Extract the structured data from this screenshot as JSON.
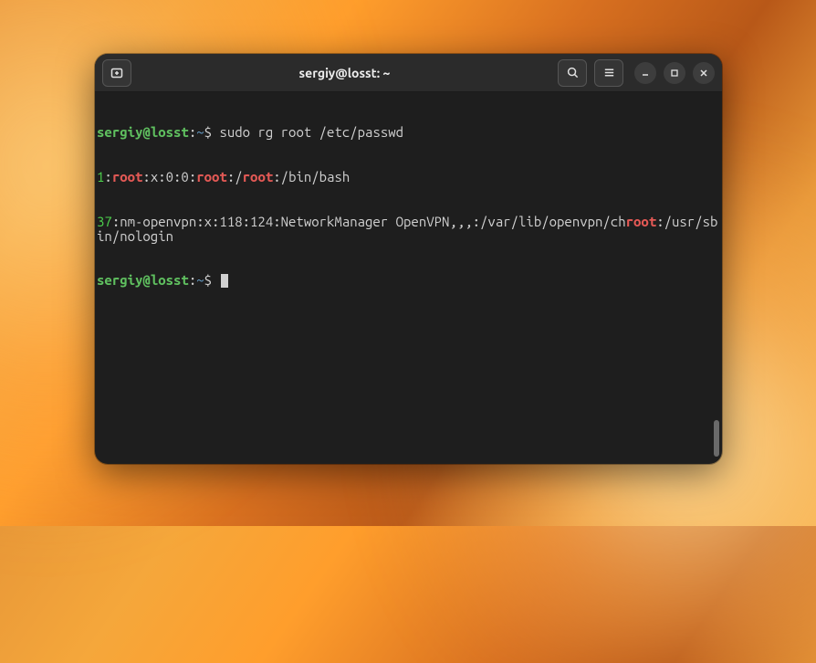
{
  "titlebar": {
    "title": "sergiy@losst: ~"
  },
  "prompt1": {
    "user": "sergiy",
    "at": "@",
    "host": "losst",
    "colon": ":",
    "tilde": "~",
    "dollar": "$ ",
    "command": "sudo rg root /etc/passwd"
  },
  "output": {
    "line1": {
      "num": "1",
      "c1": ":",
      "m1": "root",
      "t1": ":x:0:0:",
      "m2": "root",
      "t2": ":/",
      "m3": "root",
      "t3": ":/bin/bash"
    },
    "line2": {
      "num": "37",
      "c1": ":nm-openvpn:x:118:124:NetworkManager OpenVPN,,,:/var/lib/openvpn/ch",
      "m1": "root",
      "t1": ":/usr/sbin/nologin"
    }
  },
  "prompt2": {
    "user": "sergiy",
    "at": "@",
    "host": "losst",
    "colon": ":",
    "tilde": "~",
    "dollar": "$ "
  }
}
